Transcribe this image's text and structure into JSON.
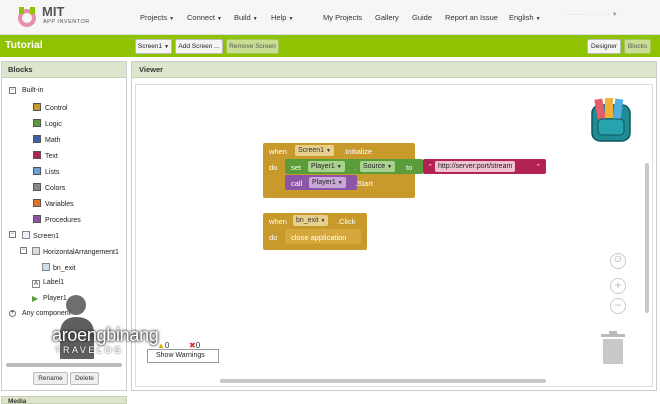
{
  "header": {
    "brand": "MIT",
    "subbrand": "APP INVENTOR",
    "nav": [
      {
        "label": "Projects"
      },
      {
        "label": "Connect"
      },
      {
        "label": "Build"
      },
      {
        "label": "Help"
      }
    ],
    "links": [
      "My Projects",
      "Gallery",
      "Guide",
      "Report an Issue"
    ],
    "language": "English"
  },
  "toolbar": {
    "project_title": "Tutorial",
    "screen_select": "Screen1",
    "add_screen": "Add Screen ...",
    "remove_screen": "Remove Screen",
    "designer": "Designer",
    "blocks": "Blocks"
  },
  "blocks_panel": {
    "title": "Blocks",
    "builtin_label": "Built-in",
    "builtin": [
      {
        "label": "Control",
        "color": "#c89a2c"
      },
      {
        "label": "Logic",
        "color": "#5a9b3a"
      },
      {
        "label": "Math",
        "color": "#3a62a8"
      },
      {
        "label": "Text",
        "color": "#b22253"
      },
      {
        "label": "Lists",
        "color": "#6ea0d8"
      },
      {
        "label": "Colors",
        "color": "#888888"
      },
      {
        "label": "Variables",
        "color": "#e0702a"
      },
      {
        "label": "Procedures",
        "color": "#8c55a5"
      }
    ],
    "screen": "Screen1",
    "arrangement": "HorizontalArrangement1",
    "button": "bn_exit",
    "label": "Label1",
    "player": "Player1",
    "any": "Any component",
    "rename": "Rename",
    "delete": "Delete",
    "media": "Media"
  },
  "viewer": {
    "title": "Viewer",
    "block1": {
      "when": "when",
      "component": "Screen1",
      "event": ".Initialize",
      "do": "do",
      "set": "set",
      "target": "Player1",
      "dot": ".",
      "property": "Source",
      "to": "to",
      "quote_open": "\"",
      "value": "http://server:port/stream",
      "quote_close": "\"",
      "call": "call",
      "call_target": "Player1",
      "method": ".Start"
    },
    "block2": {
      "when": "when",
      "component": "bn_exit",
      "event": ".Click",
      "do": "do",
      "action": "close application"
    },
    "warnings": {
      "label": "Show Warnings",
      "warn_count": "0",
      "error_count": "0"
    }
  },
  "watermark": {
    "line1": "aroengbinang",
    "line2": "TRAVELOG"
  }
}
